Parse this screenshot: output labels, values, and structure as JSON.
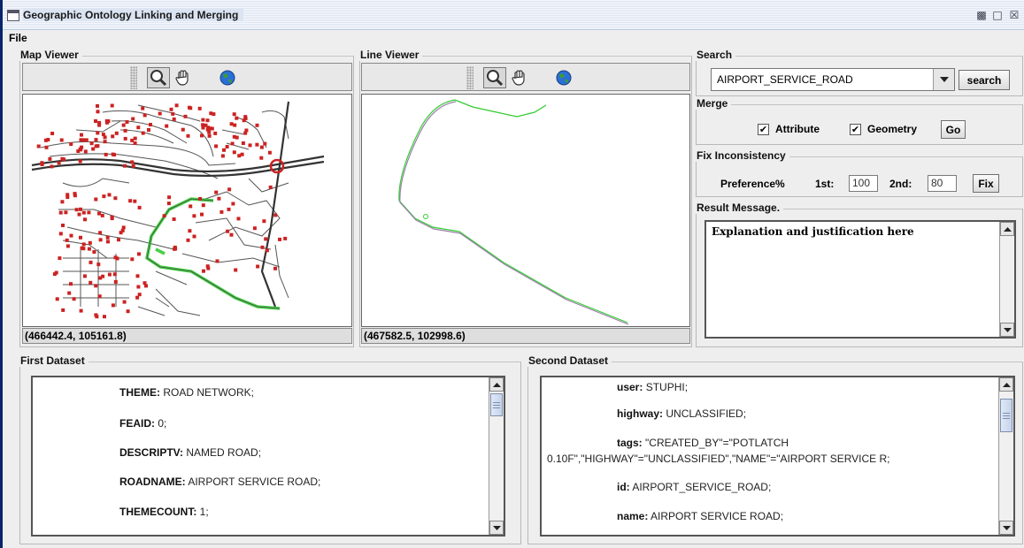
{
  "window": {
    "title": "Geographic Ontology Linking and Merging"
  },
  "menu": {
    "file": "File"
  },
  "map_viewer": {
    "title": "Map Viewer",
    "coords": "(466442.4, 105161.8)"
  },
  "line_viewer": {
    "title": "Line Viewer",
    "coords": "(467582.5, 102998.6)"
  },
  "toolbar_icons": [
    "zoom-magnifier-icon",
    "pan-hand-icon",
    "globe-icon"
  ],
  "search": {
    "title": "Search",
    "value": "AIRPORT_SERVICE_ROAD",
    "button": "search"
  },
  "merge": {
    "title": "Merge",
    "attribute_label": "Attribute",
    "attribute_checked": true,
    "geometry_label": "Geometry",
    "geometry_checked": true,
    "go_button": "Go"
  },
  "fix": {
    "title": "Fix Inconsistency",
    "pref_label": "Preference%",
    "first_label": "1st:",
    "first_value": "100",
    "second_label": "2nd:",
    "second_value": "80",
    "fix_button": "Fix"
  },
  "result": {
    "title": "Result Message.",
    "text": "Explanation and justification here"
  },
  "first_dataset": {
    "title": "First Dataset",
    "rows": [
      {
        "key": "THEME:",
        "value": "ROAD NETWORK;"
      },
      {
        "key": "FEAID:",
        "value": "0;"
      },
      {
        "key": "DESCRIPTV:",
        "value": "NAMED ROAD;"
      },
      {
        "key": "ROADNAME:",
        "value": "AIRPORT SERVICE ROAD;"
      },
      {
        "key": "THEMECOUNT:",
        "value": "1;"
      }
    ]
  },
  "second_dataset": {
    "title": "Second Dataset",
    "rows": [
      {
        "key": "user:",
        "value": "STUPHI;"
      },
      {
        "key": "highway:",
        "value": "UNCLASSIFIED;"
      },
      {
        "key": "tags:",
        "value": "\"CREATED_BY\"=\"POTLATCH"
      },
      {
        "key": "",
        "value": "0.10F\",\"HIGHWAY\"=\"UNCLASSIFIED\",\"NAME\"=\"AIRPORT SERVICE R;"
      },
      {
        "key": "id:",
        "value": "AIRPORT_SERVICE_ROAD;"
      },
      {
        "key": "name:",
        "value": "AIRPORT SERVICE ROAD;"
      }
    ]
  },
  "colors": {
    "title_accent": "#0a246a",
    "road_gray": "#555555",
    "node_red": "#cc2222",
    "highlight_green": "#33cc33",
    "line_purple": "#9a7fa8"
  }
}
